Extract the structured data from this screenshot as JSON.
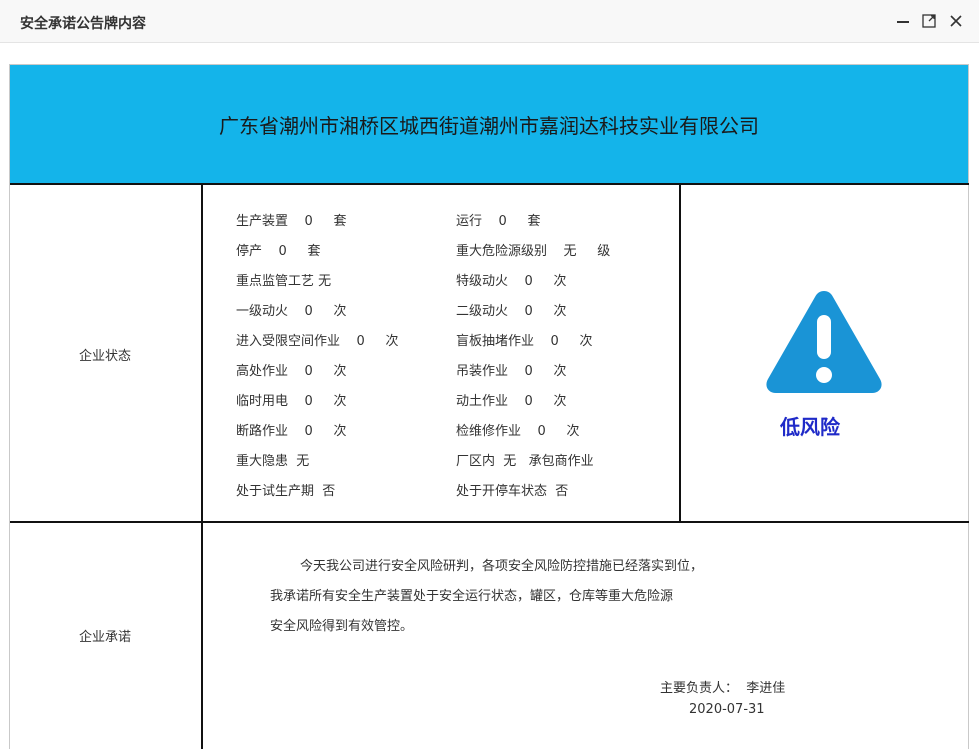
{
  "window": {
    "title": "安全承诺公告牌内容",
    "controls": [
      "minimize-icon",
      "maximize-icon",
      "close-icon"
    ]
  },
  "company": {
    "name": "广东省潮州市湘桥区城西街道潮州市嘉润达科技实业有限公司",
    "header_color": "#14b4ea"
  },
  "status": {
    "label": "企业状态",
    "left": [
      "生产装置    0     套",
      "停产    0     套",
      "重点监管工艺 无",
      "一级动火    0     次",
      "进入受限空间作业    0     次",
      "高处作业    0     次",
      "临时用电    0     次",
      "断路作业    0     次",
      "重大隐患  无",
      "处于试生产期  否"
    ],
    "right": [
      "运行    0     套",
      "重大危险源级别    无     级",
      "特级动火    0     次",
      "二级动火    0     次",
      "盲板抽堵作业    0     次",
      "吊装作业    0     次",
      "动土作业    0     次",
      "检维修作业    0     次",
      "厂区内  无   承包商作业",
      "处于开停车状态  否"
    ]
  },
  "risk": {
    "icon": "warning-triangle-icon",
    "level": "低风险",
    "icon_color": "#1a94d6",
    "level_color": "#1f2ac8"
  },
  "pledge": {
    "label": "企业承诺",
    "lines": [
      "今天我公司进行安全风险研判，各项安全风险防控措施已经落实到位，",
      "我承诺所有安全生产装置处于安全运行状态，罐区，仓库等重大危险源",
      "安全风险得到有效管控。"
    ],
    "responsible": "主要负责人：  李进佳",
    "date": "2020-07-31"
  }
}
